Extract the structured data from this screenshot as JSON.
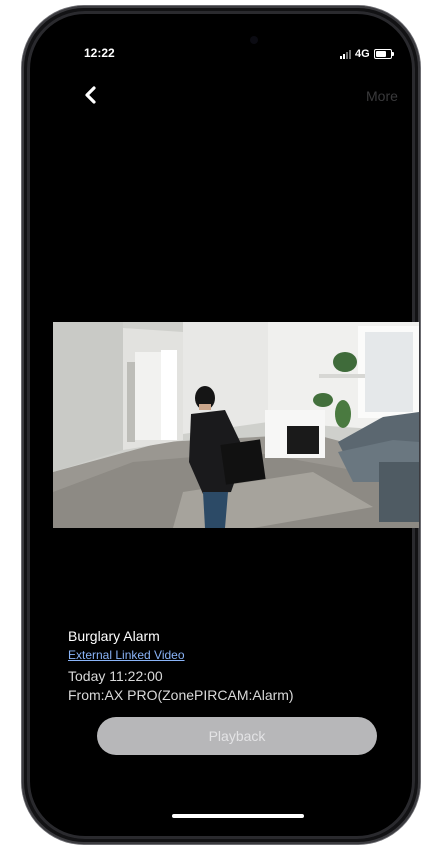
{
  "status_bar": {
    "time": "12:22",
    "network": "4G"
  },
  "nav": {
    "back_icon": "chevron-left-icon",
    "more_label": "More"
  },
  "video": {
    "description_icon": "camera-snapshot"
  },
  "event": {
    "title": "Burglary Alarm",
    "link_label": "External Linked Video",
    "time": "Today 11:22:00",
    "source": "From:AX PRO(ZonePIRCAM:Alarm)"
  },
  "actions": {
    "playback_label": "Playback"
  },
  "colors": {
    "background": "#000000",
    "link": "#8ab4f8",
    "button_disabled": "#b7b7b9"
  }
}
